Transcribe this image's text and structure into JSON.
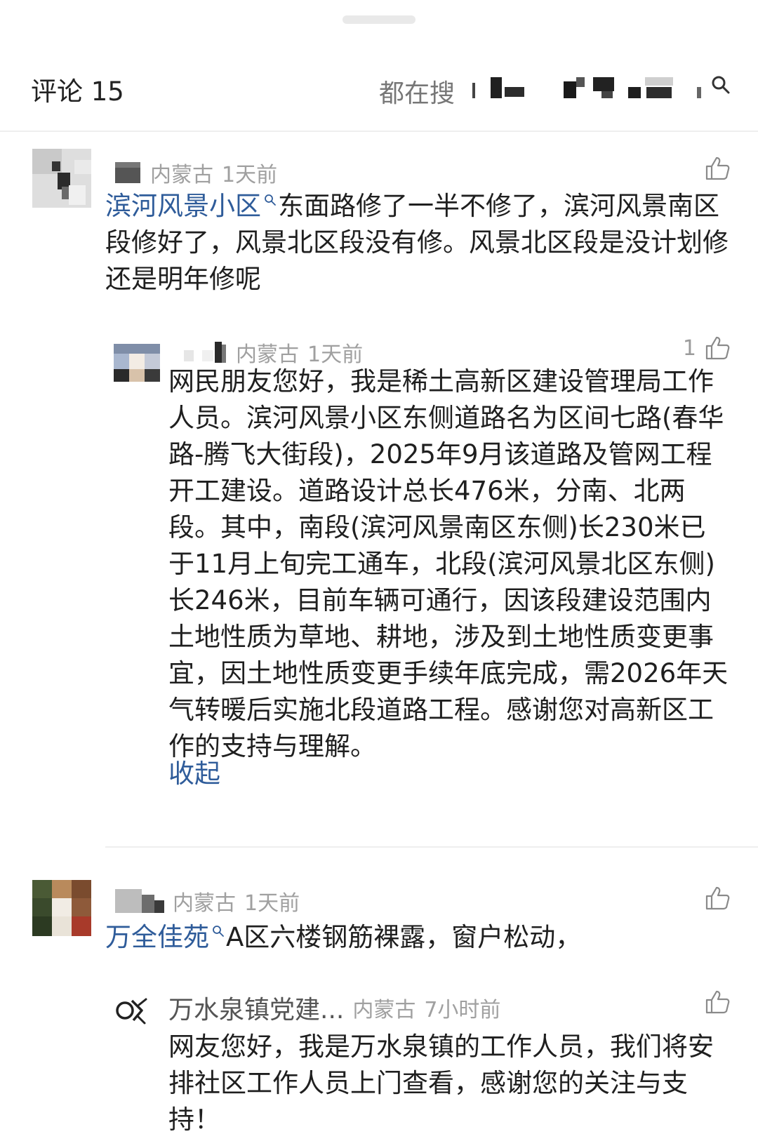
{
  "sheet": {
    "comments_title": "评论 15",
    "search_label": "都在搜"
  },
  "comments": [
    {
      "location": "内蒙古",
      "time": "1天前",
      "link_text": "滨河风景小区",
      "body_rest": "东面路修了一半不修了，滨河风景南区段修好了，风景北区段没有修。风景北区段是没计划修还是明年修呢",
      "reply": {
        "location": "内蒙古",
        "time": "1天前",
        "likes": "1",
        "body": "网民朋友您好，我是稀土高新区建设管理局工作人员。滨河风景小区东侧道路名为区间七路(春华路-腾飞大街段)，2025年9月该道路及管网工程开工建设。道路设计总长476米，分南、北两段。其中，南段(滨河风景南区东侧)长230米已于11月上旬完工通车，北段(滨河风景北区东侧)长246米，目前车辆可通行，因该段建设范围内土地性质为草地、耕地，涉及到土地性质变更事宜，因土地性质变更手续年底完成，需2026年天气转暖后实施北段道路工程。感谢您对高新区工作的支持与理解。",
        "collapse": "收起"
      }
    },
    {
      "location": "内蒙古",
      "time": "1天前",
      "link_text": "万全佳苑",
      "body_rest": "A区六楼钢筋裸露，窗户松动，",
      "reply": {
        "author": "万水泉镇党建...",
        "location": "内蒙古",
        "time": "7小时前",
        "body": "网友您好，我是万水泉镇的工作人员，我们将安排社区工作人员上门查看，感谢您的关注与支持！"
      }
    }
  ],
  "colors": {
    "link": "#2f5c9a",
    "meta": "#a0a0a0",
    "text": "#1f1f1f"
  },
  "icons": [
    "search-icon",
    "like-icon",
    "avatar-logo-icon"
  ]
}
